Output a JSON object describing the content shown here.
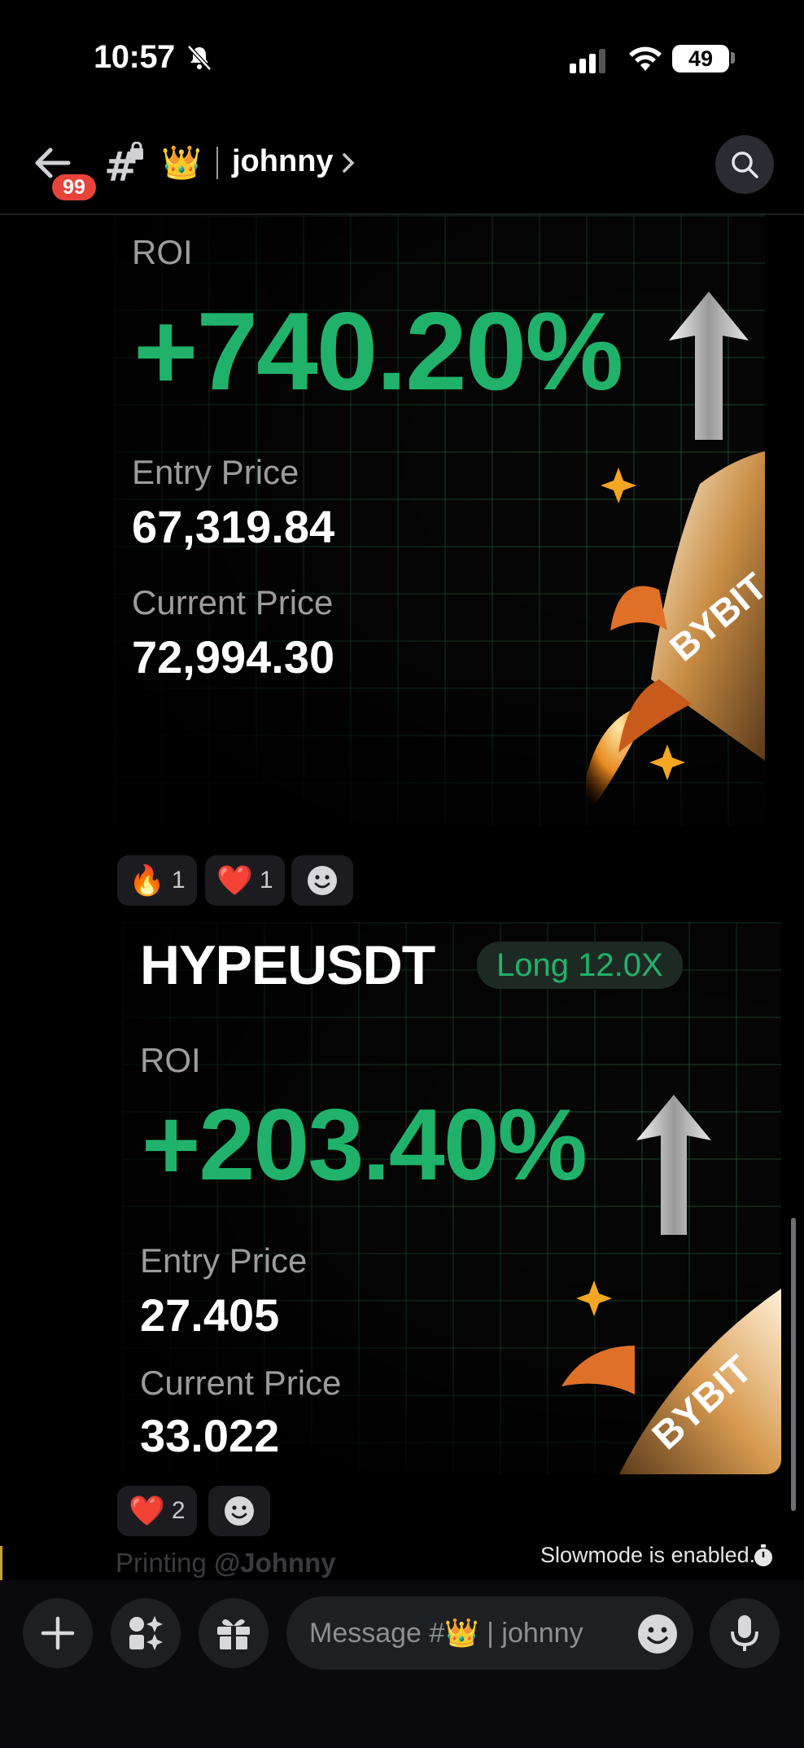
{
  "status_bar": {
    "time": "10:57",
    "battery": "49"
  },
  "header": {
    "unread_badge": "99",
    "channel_emoji": "👑",
    "channel_name": "johnny"
  },
  "messages": [
    {
      "pair": "",
      "roi_label": "ROI",
      "roi_value": "+740.20%",
      "entry_label": "Entry Price",
      "entry_value": "67,319.84",
      "current_label": "Current Price",
      "current_value": "72,994.30",
      "brand": "BYBIT",
      "reactions": [
        {
          "emoji": "🔥",
          "count": "1"
        },
        {
          "emoji": "❤️",
          "count": "1"
        }
      ]
    },
    {
      "pair": "HYPEUSDT",
      "position_pill": "Long 12.0X",
      "roi_label": "ROI",
      "roi_value": "+203.40%",
      "entry_label": "Entry Price",
      "entry_value": "27.405",
      "current_label": "Current Price",
      "current_value": "33.022",
      "brand": "BYBIT",
      "reactions": [
        {
          "emoji": "❤️",
          "count": "2"
        }
      ]
    }
  ],
  "typing_preview": {
    "text": "Printing",
    "mention": "@Johnny"
  },
  "slowmode_text": "Slowmode is enabled.",
  "composer": {
    "placeholder_prefix": "Message #",
    "placeholder_emoji": "👑",
    "placeholder_suffix": "| johnny"
  },
  "colors": {
    "accent_green": "#20b26b",
    "badge_red": "#e8443a",
    "background": "#000000"
  }
}
